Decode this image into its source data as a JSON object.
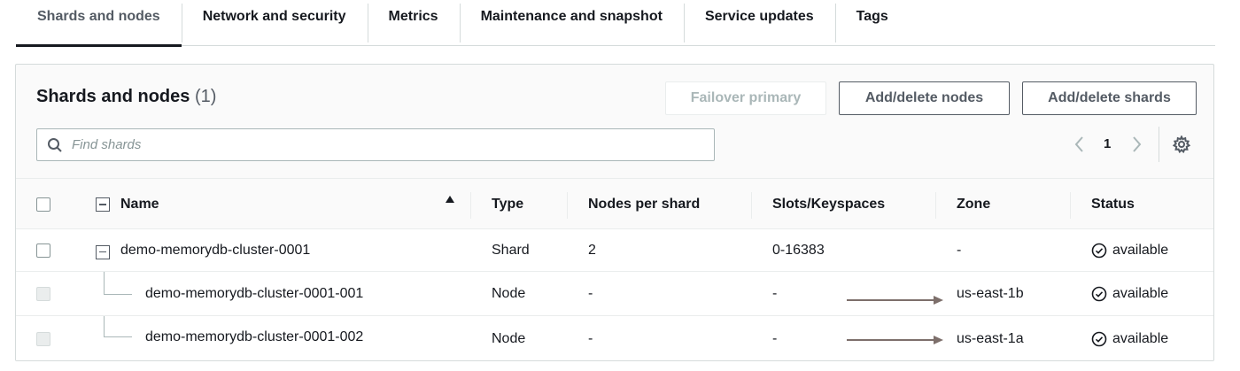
{
  "tabs": [
    {
      "label": "Shards and nodes",
      "active": true
    },
    {
      "label": "Network and security"
    },
    {
      "label": "Metrics"
    },
    {
      "label": "Maintenance and snapshot"
    },
    {
      "label": "Service updates"
    },
    {
      "label": "Tags"
    }
  ],
  "panel": {
    "title": "Shards and nodes",
    "count": "(1)",
    "buttons": {
      "failover": "Failover primary",
      "add_delete_nodes": "Add/delete nodes",
      "add_delete_shards": "Add/delete shards"
    },
    "search": {
      "placeholder": "Find shards",
      "value": ""
    },
    "pagination": {
      "current_page": "1"
    }
  },
  "table": {
    "columns": [
      "Name",
      "Type",
      "Nodes per shard",
      "Slots/Keyspaces",
      "Zone",
      "Status"
    ],
    "sorted_column": "Name",
    "sort_direction": "ascending",
    "rows": [
      {
        "name": "demo-memorydb-cluster-0001",
        "type": "Shard",
        "nodes_per_shard": "2",
        "slots": "0-16383",
        "zone": "-",
        "status": "available",
        "level": "shard"
      },
      {
        "name": "demo-memorydb-cluster-0001-001",
        "type": "Node",
        "nodes_per_shard": "-",
        "slots": "-",
        "zone": "us-east-1b",
        "status": "available",
        "level": "node"
      },
      {
        "name": "demo-memorydb-cluster-0001-002",
        "type": "Node",
        "nodes_per_shard": "-",
        "slots": "-",
        "zone": "us-east-1a",
        "status": "available",
        "level": "node"
      }
    ]
  },
  "colors": {
    "text": "#16191f",
    "muted": "#545b64",
    "border": "#d5dbdb",
    "status_icon": "#1d8102",
    "annotation_arrow": "#7d6f6b"
  },
  "icons": {
    "search": "search-icon",
    "prev": "chevron-left-icon",
    "next": "chevron-right-icon",
    "settings": "gear-icon",
    "sort": "sort-ascending-icon",
    "status": "check-circle-icon"
  }
}
